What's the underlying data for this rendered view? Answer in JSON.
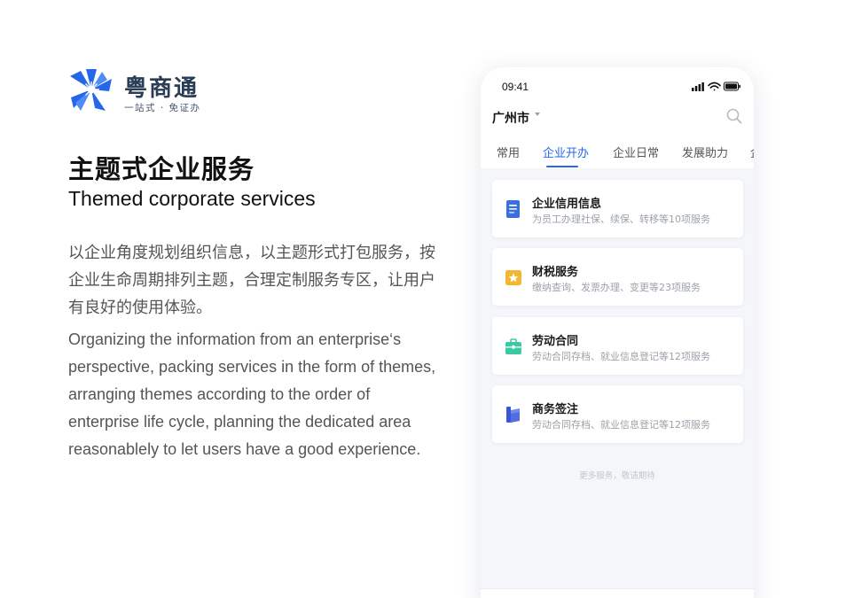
{
  "brand": {
    "name": "粤商通",
    "slogan": "一站式 · 免证办",
    "colors": {
      "primary": "#2567e8",
      "text": "#2a3d57"
    }
  },
  "heading": {
    "title_zh": "主题式企业服务",
    "title_en": "Themed corporate services"
  },
  "description": {
    "zh": "以企业角度规划组织信息，以主题形式打包服务，按企业生命周期排列主题，合理定制服务专区，让用户有良好的使用体验。",
    "en": "Organizing the information from an enterprise‘s perspective, packing services in the form of themes, arranging themes according to the order of enterprise life cycle, planning the dedicated area reasonablely to let users have a good experience."
  },
  "phone": {
    "status": {
      "time": "09:41",
      "icons": [
        "signal-icon",
        "wifi-icon",
        "battery-icon"
      ]
    },
    "city": "广州市",
    "search_icon": "search-icon",
    "tabs": [
      {
        "label": "常用",
        "active": false
      },
      {
        "label": "企业开办",
        "active": true
      },
      {
        "label": "企业日常",
        "active": false
      },
      {
        "label": "发展助力",
        "active": false
      },
      {
        "label": "企",
        "active": false
      }
    ],
    "cards": [
      {
        "title": "企业信用信息",
        "subtitle": "为员工办理社保、续保、转移等10项服务",
        "icon": "document-icon",
        "color": "#3a6fe0"
      },
      {
        "title": "财税服务",
        "subtitle": "缴纳查询、发票办理、变更等23项服务",
        "icon": "star-badge-icon",
        "color": "#f5b731"
      },
      {
        "title": "劳动合同",
        "subtitle": "劳动合同存档、就业信息登记等12项服务",
        "icon": "briefcase-icon",
        "color": "#3bc9a4"
      },
      {
        "title": "商务签注",
        "subtitle": "劳动合同存档、就业信息登记等12项服务",
        "icon": "bookmark-book-icon",
        "color": "#3a56d6"
      }
    ],
    "more_text": "更多服务，敬请期待"
  }
}
